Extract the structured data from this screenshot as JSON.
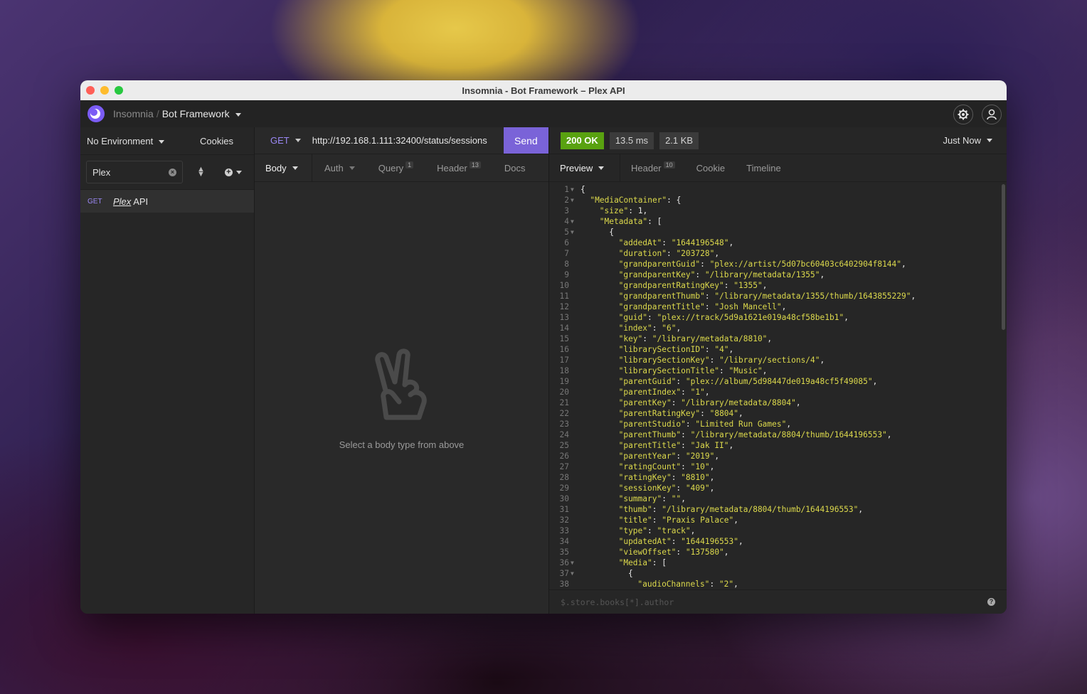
{
  "window": {
    "title": "Insomnia - Bot Framework – Plex API"
  },
  "appbar": {
    "app_name": "Insomnia",
    "separator": "/",
    "workspace": "Bot Framework",
    "settings_icon": "gear-icon",
    "account_icon": "user-icon"
  },
  "sidebar": {
    "environment": "No Environment",
    "cookies": "Cookies",
    "filter_value": "Plex",
    "requests": [
      {
        "method": "GET",
        "name_em": "Plex",
        "name_rest": " API"
      }
    ]
  },
  "request": {
    "method": "GET",
    "url": "http://192.168.1.111:32400/status/sessions",
    "send_label": "Send",
    "tabs": [
      {
        "label": "Body",
        "badge": ""
      },
      {
        "label": "Auth",
        "badge": ""
      },
      {
        "label": "Query",
        "badge": "1"
      },
      {
        "label": "Header",
        "badge": "13"
      },
      {
        "label": "Docs",
        "badge": ""
      }
    ],
    "empty_message": "Select a body type from above"
  },
  "response": {
    "status": "200 OK",
    "time": "13.5 ms",
    "size": "2.1 KB",
    "when": "Just Now",
    "tabs": [
      {
        "label": "Preview",
        "badge": ""
      },
      {
        "label": "Header",
        "badge": "10"
      },
      {
        "label": "Cookie",
        "badge": ""
      },
      {
        "label": "Timeline",
        "badge": ""
      }
    ],
    "filter_placeholder": "$.store.books[*].author",
    "colors": {
      "string": "#dcd94c",
      "status_ok": "#59a210",
      "accent": "#7a63d8"
    },
    "lines": [
      {
        "n": "1",
        "fold": true,
        "indent": 0,
        "key": "",
        "sep": "",
        "val": "",
        "punct": "{"
      },
      {
        "n": "2",
        "fold": true,
        "indent": 1,
        "key": "\"MediaContainer\"",
        "sep": ": ",
        "val": "",
        "punct": "{"
      },
      {
        "n": "3",
        "fold": false,
        "indent": 2,
        "key": "\"size\"",
        "sep": ": ",
        "val": "1",
        "punct": ","
      },
      {
        "n": "4",
        "fold": true,
        "indent": 2,
        "key": "\"Metadata\"",
        "sep": ": ",
        "val": "",
        "punct": "["
      },
      {
        "n": "5",
        "fold": true,
        "indent": 3,
        "key": "",
        "sep": "",
        "val": "",
        "punct": "{"
      },
      {
        "n": "6",
        "fold": false,
        "indent": 4,
        "key": "\"addedAt\"",
        "sep": ": ",
        "val": "\"1644196548\"",
        "punct": ","
      },
      {
        "n": "7",
        "fold": false,
        "indent": 4,
        "key": "\"duration\"",
        "sep": ": ",
        "val": "\"203728\"",
        "punct": ","
      },
      {
        "n": "8",
        "fold": false,
        "indent": 4,
        "key": "\"grandparentGuid\"",
        "sep": ": ",
        "val": "\"plex://artist/5d07bc60403c6402904f8144\"",
        "punct": ","
      },
      {
        "n": "9",
        "fold": false,
        "indent": 4,
        "key": "\"grandparentKey\"",
        "sep": ": ",
        "val": "\"/library/metadata/1355\"",
        "punct": ","
      },
      {
        "n": "10",
        "fold": false,
        "indent": 4,
        "key": "\"grandparentRatingKey\"",
        "sep": ": ",
        "val": "\"1355\"",
        "punct": ","
      },
      {
        "n": "11",
        "fold": false,
        "indent": 4,
        "key": "\"grandparentThumb\"",
        "sep": ": ",
        "val": "\"/library/metadata/1355/thumb/1643855229\"",
        "punct": ","
      },
      {
        "n": "12",
        "fold": false,
        "indent": 4,
        "key": "\"grandparentTitle\"",
        "sep": ": ",
        "val": "\"Josh Mancell\"",
        "punct": ","
      },
      {
        "n": "13",
        "fold": false,
        "indent": 4,
        "key": "\"guid\"",
        "sep": ": ",
        "val": "\"plex://track/5d9a1621e019a48cf58be1b1\"",
        "punct": ","
      },
      {
        "n": "14",
        "fold": false,
        "indent": 4,
        "key": "\"index\"",
        "sep": ": ",
        "val": "\"6\"",
        "punct": ","
      },
      {
        "n": "15",
        "fold": false,
        "indent": 4,
        "key": "\"key\"",
        "sep": ": ",
        "val": "\"/library/metadata/8810\"",
        "punct": ","
      },
      {
        "n": "16",
        "fold": false,
        "indent": 4,
        "key": "\"librarySectionID\"",
        "sep": ": ",
        "val": "\"4\"",
        "punct": ","
      },
      {
        "n": "17",
        "fold": false,
        "indent": 4,
        "key": "\"librarySectionKey\"",
        "sep": ": ",
        "val": "\"/library/sections/4\"",
        "punct": ","
      },
      {
        "n": "18",
        "fold": false,
        "indent": 4,
        "key": "\"librarySectionTitle\"",
        "sep": ": ",
        "val": "\"Music\"",
        "punct": ","
      },
      {
        "n": "19",
        "fold": false,
        "indent": 4,
        "key": "\"parentGuid\"",
        "sep": ": ",
        "val": "\"plex://album/5d98447de019a48cf5f49085\"",
        "punct": ","
      },
      {
        "n": "20",
        "fold": false,
        "indent": 4,
        "key": "\"parentIndex\"",
        "sep": ": ",
        "val": "\"1\"",
        "punct": ","
      },
      {
        "n": "21",
        "fold": false,
        "indent": 4,
        "key": "\"parentKey\"",
        "sep": ": ",
        "val": "\"/library/metadata/8804\"",
        "punct": ","
      },
      {
        "n": "22",
        "fold": false,
        "indent": 4,
        "key": "\"parentRatingKey\"",
        "sep": ": ",
        "val": "\"8804\"",
        "punct": ","
      },
      {
        "n": "23",
        "fold": false,
        "indent": 4,
        "key": "\"parentStudio\"",
        "sep": ": ",
        "val": "\"Limited Run Games\"",
        "punct": ","
      },
      {
        "n": "24",
        "fold": false,
        "indent": 4,
        "key": "\"parentThumb\"",
        "sep": ": ",
        "val": "\"/library/metadata/8804/thumb/1644196553\"",
        "punct": ","
      },
      {
        "n": "25",
        "fold": false,
        "indent": 4,
        "key": "\"parentTitle\"",
        "sep": ": ",
        "val": "\"Jak II\"",
        "punct": ","
      },
      {
        "n": "26",
        "fold": false,
        "indent": 4,
        "key": "\"parentYear\"",
        "sep": ": ",
        "val": "\"2019\"",
        "punct": ","
      },
      {
        "n": "27",
        "fold": false,
        "indent": 4,
        "key": "\"ratingCount\"",
        "sep": ": ",
        "val": "\"10\"",
        "punct": ","
      },
      {
        "n": "28",
        "fold": false,
        "indent": 4,
        "key": "\"ratingKey\"",
        "sep": ": ",
        "val": "\"8810\"",
        "punct": ","
      },
      {
        "n": "29",
        "fold": false,
        "indent": 4,
        "key": "\"sessionKey\"",
        "sep": ": ",
        "val": "\"409\"",
        "punct": ","
      },
      {
        "n": "30",
        "fold": false,
        "indent": 4,
        "key": "\"summary\"",
        "sep": ": ",
        "val": "\"\"",
        "punct": ","
      },
      {
        "n": "31",
        "fold": false,
        "indent": 4,
        "key": "\"thumb\"",
        "sep": ": ",
        "val": "\"/library/metadata/8804/thumb/1644196553\"",
        "punct": ","
      },
      {
        "n": "32",
        "fold": false,
        "indent": 4,
        "key": "\"title\"",
        "sep": ": ",
        "val": "\"Praxis Palace\"",
        "punct": ","
      },
      {
        "n": "33",
        "fold": false,
        "indent": 4,
        "key": "\"type\"",
        "sep": ": ",
        "val": "\"track\"",
        "punct": ","
      },
      {
        "n": "34",
        "fold": false,
        "indent": 4,
        "key": "\"updatedAt\"",
        "sep": ": ",
        "val": "\"1644196553\"",
        "punct": ","
      },
      {
        "n": "35",
        "fold": false,
        "indent": 4,
        "key": "\"viewOffset\"",
        "sep": ": ",
        "val": "\"137580\"",
        "punct": ","
      },
      {
        "n": "36",
        "fold": true,
        "indent": 4,
        "key": "\"Media\"",
        "sep": ": ",
        "val": "",
        "punct": "["
      },
      {
        "n": "37",
        "fold": true,
        "indent": 5,
        "key": "",
        "sep": "",
        "val": "",
        "punct": "{"
      },
      {
        "n": "38",
        "fold": false,
        "indent": 6,
        "key": "\"audioChannels\"",
        "sep": ": ",
        "val": "\"2\"",
        "punct": ","
      }
    ]
  }
}
